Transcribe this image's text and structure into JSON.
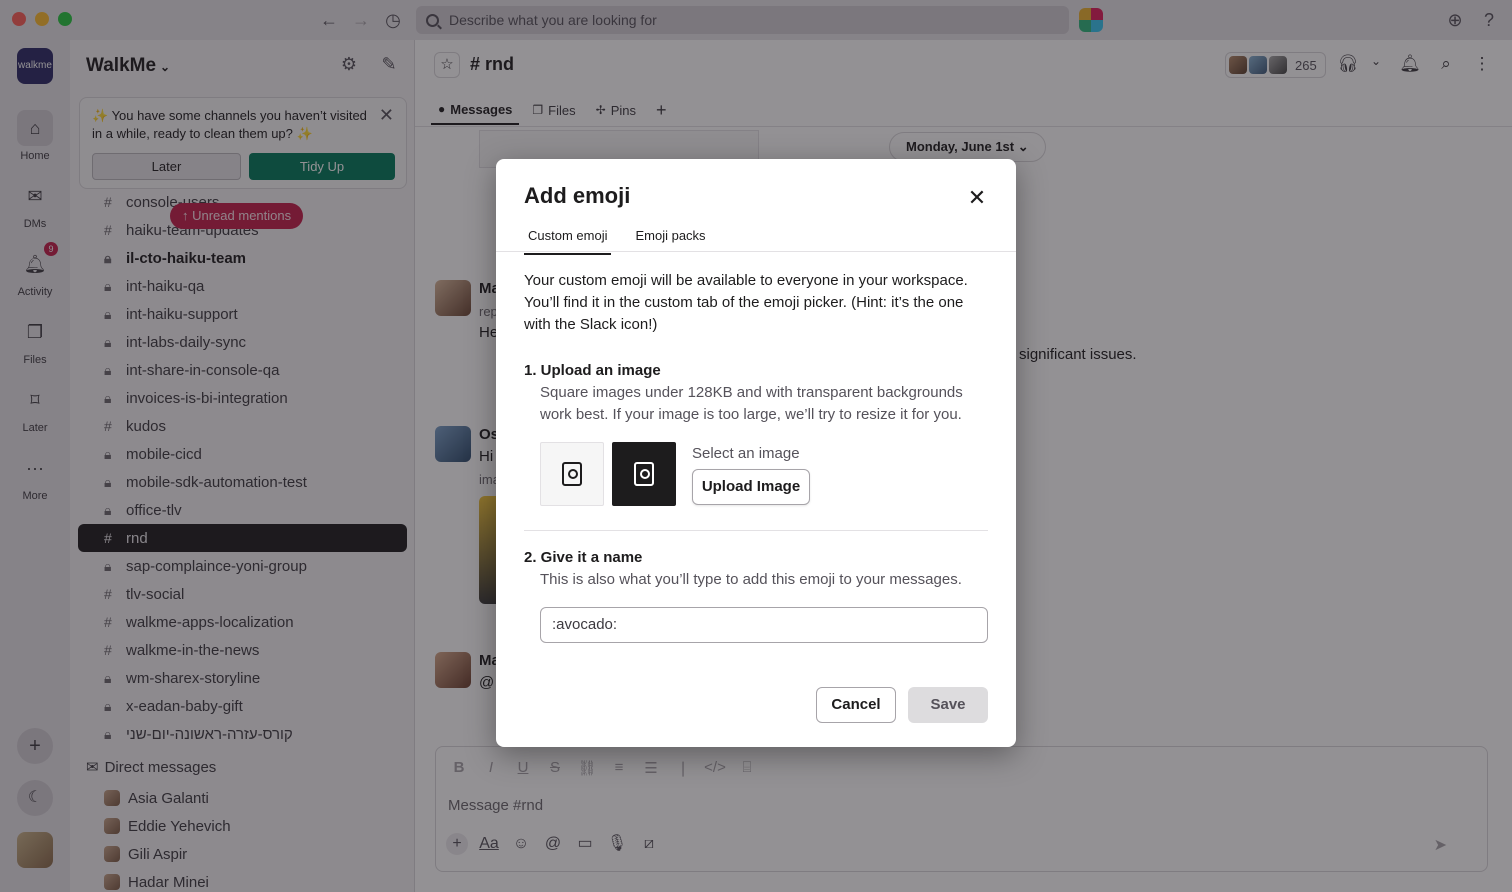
{
  "titlebar": {
    "search_placeholder": "Describe what you are looking for"
  },
  "rail": {
    "workspace_logo": "walkme",
    "items": [
      {
        "label": "Home",
        "icon": "home-icon"
      },
      {
        "label": "DMs",
        "icon": "dms-icon"
      },
      {
        "label": "Activity",
        "icon": "bell-icon",
        "badge": "9"
      },
      {
        "label": "Files",
        "icon": "files-icon"
      },
      {
        "label": "Later",
        "icon": "bookmark-icon"
      },
      {
        "label": "More",
        "icon": "more-icon"
      }
    ]
  },
  "sidebar": {
    "workspace_name": "WalkMe",
    "tidy_banner": {
      "text": "✨ You have some channels you haven’t visited in a while, ready to clean them up? ✨",
      "later_label": "Later",
      "tidy_label": "Tidy Up"
    },
    "unread_mentions": "↑ Unread mentions",
    "channels": [
      {
        "name": "console-users",
        "type": "hash"
      },
      {
        "name": "haiku-team-updates",
        "type": "hash"
      },
      {
        "name": "il-cto-haiku-team",
        "type": "lock",
        "bold": true
      },
      {
        "name": "int-haiku-qa",
        "type": "lock"
      },
      {
        "name": "int-haiku-support",
        "type": "lock"
      },
      {
        "name": "int-labs-daily-sync",
        "type": "lock"
      },
      {
        "name": "int-share-in-console-qa",
        "type": "lock"
      },
      {
        "name": "invoices-is-bi-integration",
        "type": "lock"
      },
      {
        "name": "kudos",
        "type": "hash"
      },
      {
        "name": "mobile-cicd",
        "type": "lock"
      },
      {
        "name": "mobile-sdk-automation-test",
        "type": "lock"
      },
      {
        "name": "office-tlv",
        "type": "lock"
      },
      {
        "name": "rnd",
        "type": "hash",
        "active": true
      },
      {
        "name": "sap-complaince-yoni-group",
        "type": "lock"
      },
      {
        "name": "tlv-social",
        "type": "hash"
      },
      {
        "name": "walkme-apps-localization",
        "type": "hash"
      },
      {
        "name": "walkme-in-the-news",
        "type": "hash"
      },
      {
        "name": "wm-sharex-storyline",
        "type": "lock"
      },
      {
        "name": "x-eadan-baby-gift",
        "type": "lock"
      },
      {
        "name": "קורס-עזרה-ראשונה-יום-שני",
        "type": "lock"
      }
    ],
    "dm_header": "Direct messages",
    "dms": [
      "Asia Galanti",
      "Eddie Yehevich",
      "Gili Aspir",
      "Hadar Minei"
    ]
  },
  "channel": {
    "title": "# rnd",
    "member_count": "265",
    "tabs": [
      {
        "label": "Messages",
        "active": true
      },
      {
        "label": "Files"
      },
      {
        "label": "Pins"
      }
    ],
    "date_divider": "Monday, June 1st ⌄",
    "visible_fragments": {
      "name1": "Ma",
      "line1a": "rep",
      "line1b": "He",
      "issues": "significant issues.",
      "name2": "Os",
      "line2a": "Hi",
      "line2b": "ima",
      "name3": "Ma",
      "line3a": "@"
    },
    "composer_placeholder": "Message #rnd"
  },
  "modal": {
    "title": "Add emoji",
    "tabs": [
      "Custom emoji",
      "Emoji packs"
    ],
    "intro": "Your custom emoji will be available to everyone in your workspace. You’ll find it in the custom tab of the emoji picker. (Hint: it’s the one with the Slack icon!)",
    "step1_title": "1. Upload an image",
    "step1_desc": "Square images under 128KB and with transparent backgrounds work best. If your image is too large, we’ll try to resize it for you.",
    "select_label": "Select an image",
    "upload_label": "Upload Image",
    "step2_title": "2. Give it a name",
    "step2_desc": "This is also what you’ll type to add this emoji to your messages.",
    "name_value": ":avocado:",
    "cancel_label": "Cancel",
    "save_label": "Save"
  },
  "colors": {
    "accent_green": "#007a5a",
    "mention_red": "#c31e4a",
    "active_channel_bg": "#1d1c1d"
  }
}
